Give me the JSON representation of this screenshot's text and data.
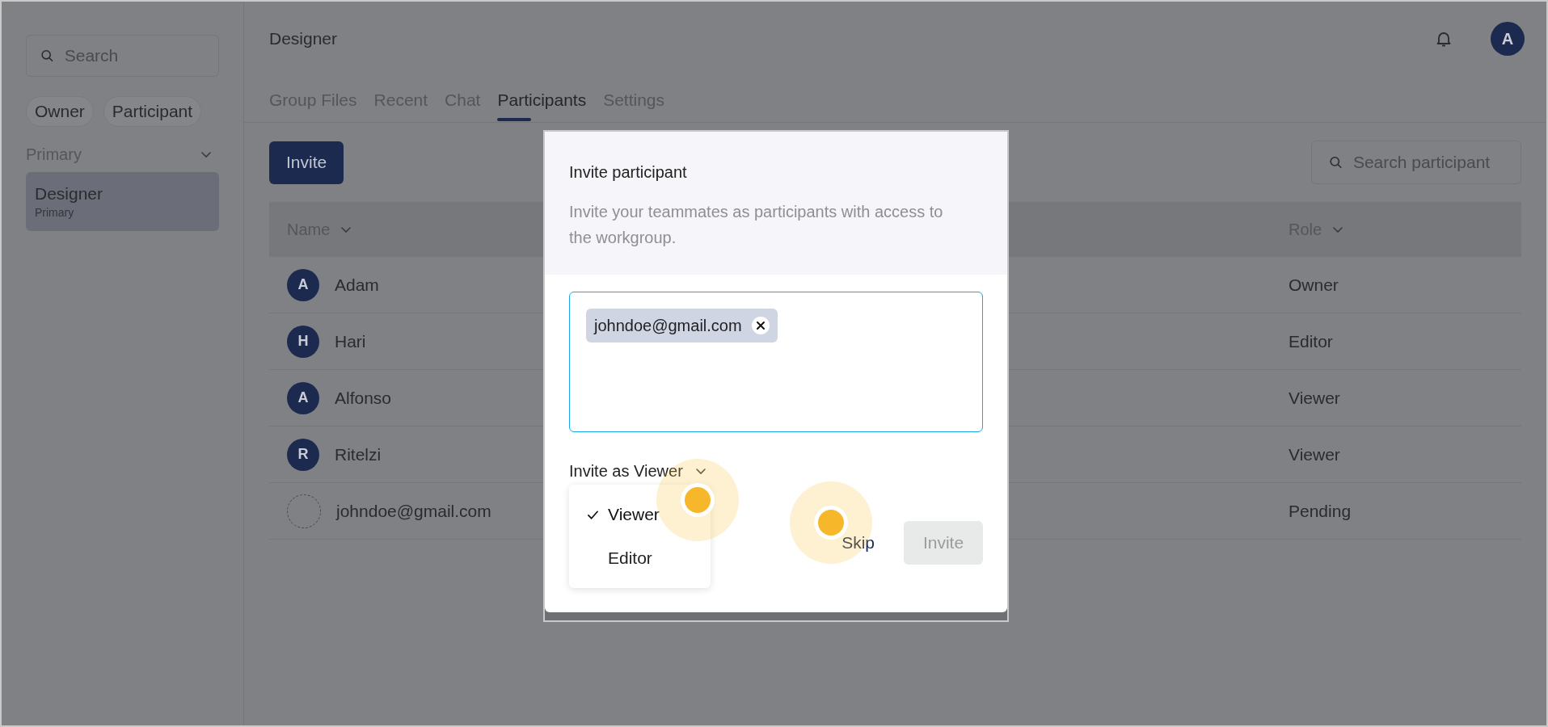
{
  "sidebar": {
    "search": {
      "placeholder": "Search"
    },
    "filters": [
      {
        "label": "Owner"
      },
      {
        "label": "Participant"
      }
    ],
    "section": {
      "title": "Primary",
      "expanded": true
    },
    "items": [
      {
        "title": "Designer",
        "subtitle": "Primary",
        "selected": true
      }
    ]
  },
  "header": {
    "title": "Designer",
    "avatar": "A"
  },
  "tabs": [
    {
      "label": "Group Files",
      "selected": false
    },
    {
      "label": "Recent",
      "selected": false
    },
    {
      "label": "Chat",
      "selected": false
    },
    {
      "label": "Participants",
      "selected": true
    },
    {
      "label": "Settings",
      "selected": false
    }
  ],
  "toolbar": {
    "invite_button": "Invite",
    "search": {
      "placeholder": "Search participant"
    }
  },
  "table": {
    "columns": [
      {
        "label": "Name"
      },
      {
        "label": "Role"
      }
    ],
    "rows": [
      {
        "kind": "member",
        "avatar": "A",
        "name": "Adam",
        "role": "Owner"
      },
      {
        "kind": "member",
        "avatar": "H",
        "name": "Hari",
        "role": "Editor"
      },
      {
        "kind": "member",
        "avatar": "A",
        "name": "Alfonso",
        "role": "Viewer"
      },
      {
        "kind": "member",
        "avatar": "R",
        "name": "Ritelzi",
        "role": "Viewer"
      },
      {
        "kind": "pending",
        "name": "johndoe@gmail.com",
        "role": "Pending"
      }
    ]
  },
  "dialog": {
    "title": "Invite participant",
    "description": "Invite your teammates as participants with access to the workgroup.",
    "emails": [
      "johndoe@gmail.com"
    ],
    "role_label": "Invite as Viewer",
    "menu": [
      {
        "label": "Viewer",
        "selected": true
      },
      {
        "label": "Editor",
        "selected": false
      }
    ],
    "skip": "Skip",
    "invite": {
      "label": "Invite",
      "disabled": true
    }
  }
}
